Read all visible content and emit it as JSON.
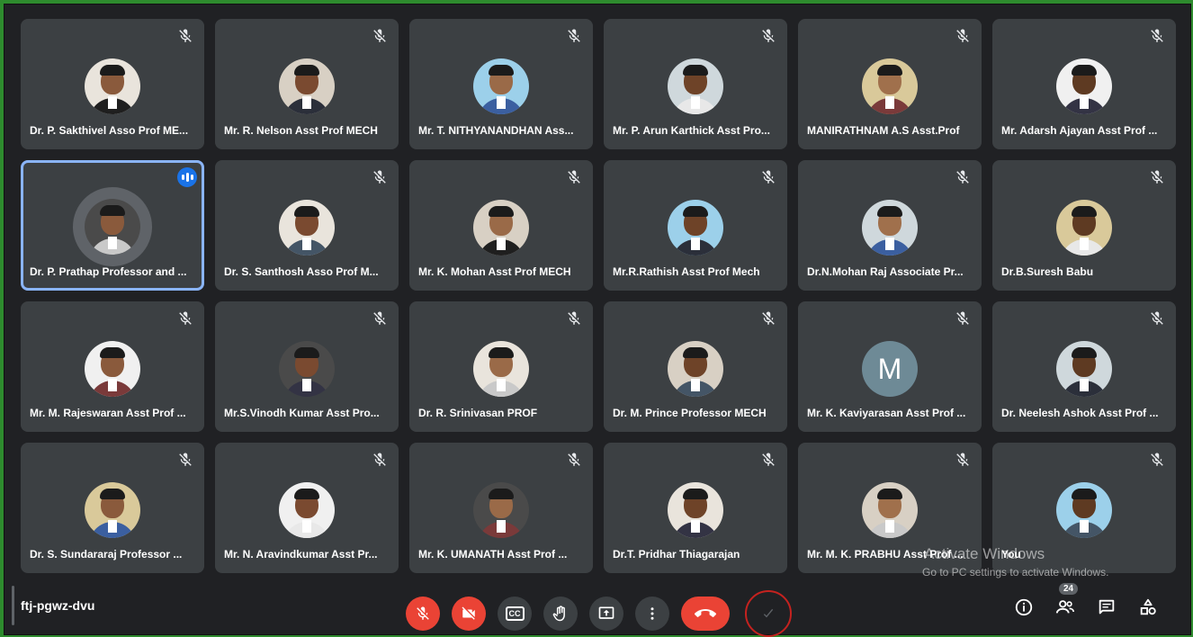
{
  "participants": [
    {
      "name": "Dr. P. Sakthivel Asso Prof ME...",
      "muted": true
    },
    {
      "name": "Mr. R. Nelson Asst Prof MECH",
      "muted": true
    },
    {
      "name": "Mr. T. NITHYANANDHAN Ass...",
      "muted": true
    },
    {
      "name": "Mr. P. Arun Karthick Asst Pro...",
      "muted": true
    },
    {
      "name": "MANIRATHNAM A.S Asst.Prof",
      "muted": true
    },
    {
      "name": "Mr. Adarsh Ajayan Asst Prof ...",
      "muted": true
    },
    {
      "name": "Dr. P. Prathap Professor and ...",
      "muted": false,
      "speaking": true
    },
    {
      "name": "Dr. S. Santhosh Asso Prof M...",
      "muted": true
    },
    {
      "name": "Mr. K. Mohan Asst Prof MECH",
      "muted": true
    },
    {
      "name": "Mr.R.Rathish Asst Prof Mech",
      "muted": true
    },
    {
      "name": "Dr.N.Mohan Raj Associate Pr...",
      "muted": true
    },
    {
      "name": "Dr.B.Suresh Babu",
      "muted": true
    },
    {
      "name": "Mr. M. Rajeswaran Asst Prof ...",
      "muted": true
    },
    {
      "name": "Mr.S.Vinodh Kumar Asst Pro...",
      "muted": true
    },
    {
      "name": "Dr. R. Srinivasan PROF",
      "muted": true
    },
    {
      "name": "Dr. M. Prince Professor MECH",
      "muted": true
    },
    {
      "name": "Mr. K. Kaviyarasan Asst Prof ...",
      "muted": true,
      "initial": "M"
    },
    {
      "name": "Dr. Neelesh Ashok Asst Prof ...",
      "muted": true
    },
    {
      "name": "Dr. S. Sundararaj Professor ...",
      "muted": true
    },
    {
      "name": "Mr. N. Aravindkumar Asst Pr...",
      "muted": true
    },
    {
      "name": "Mr. K. UMANATH Asst Prof ...",
      "muted": true
    },
    {
      "name": "Dr.T. Pridhar Thiagarajan",
      "muted": true
    },
    {
      "name": "Mr. M. K. PRABHU Asst Prof ...",
      "muted": true
    },
    {
      "name": "You",
      "muted": true
    }
  ],
  "meeting": {
    "code": "ftj-pgwz-dvu"
  },
  "controls": {
    "mic": "mic-off-icon",
    "camera": "camera-off-icon",
    "captions": "CC",
    "hand": "raise-hand-icon",
    "present": "present-icon",
    "more": "more-vert-icon",
    "end": "end-call-icon"
  },
  "side": {
    "people_count": "24"
  },
  "watermark": {
    "title": "Activate Windows",
    "subtitle": "Go to PC settings to activate Windows."
  },
  "colors": {
    "accent": "#8ab4f8",
    "danger": "#ea4335",
    "tile": "#3c4043",
    "bg": "#202124"
  }
}
